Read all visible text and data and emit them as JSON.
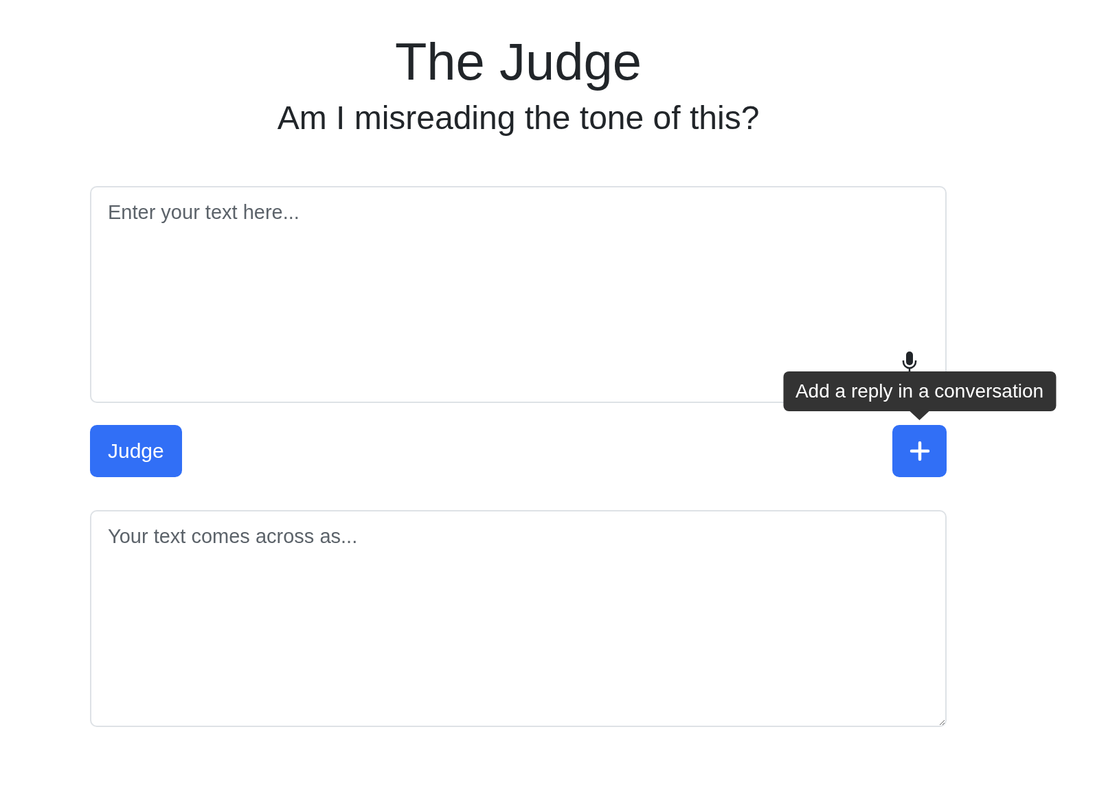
{
  "title": "The Judge",
  "subtitle": "Am I misreading the tone of this?",
  "input": {
    "placeholder": "Enter your text here..."
  },
  "judge_button": {
    "label": "Judge"
  },
  "add_button": {
    "tooltip": "Add a reply in a conversation"
  },
  "output": {
    "placeholder": "Your text comes across as..."
  }
}
